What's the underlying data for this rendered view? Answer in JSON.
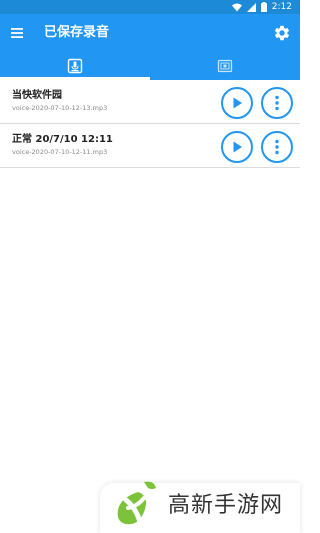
{
  "status_bar": {
    "time": "2:12",
    "icons": [
      "wifi-icon",
      "signal-icon",
      "battery-icon"
    ]
  },
  "app_bar": {
    "title": "已保存录音",
    "menu_icon": "hamburger-menu-icon",
    "settings_icon": "gear-icon"
  },
  "tabs": [
    {
      "icon": "microphone-download-icon",
      "selected": true
    },
    {
      "icon": "folder-icon",
      "selected": false
    }
  ],
  "recordings": [
    {
      "title": "当快软件园",
      "filename": "voice-2020-07-10-12-13.mp3"
    },
    {
      "title": "正常 20/7/10 12:11",
      "filename": "voice-2020-07-10-12-11.mp3"
    }
  ],
  "watermark": {
    "text": "高新手游网"
  },
  "colors": {
    "status_bar": "#1d8ad7",
    "primary": "#2196f3",
    "row_divider": "#dcdcdc",
    "logo_green": "#7cc33a"
  }
}
